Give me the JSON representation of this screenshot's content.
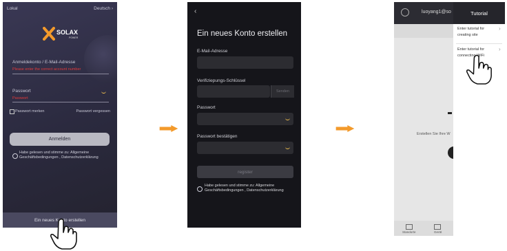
{
  "login": {
    "mode_label": "Lokal",
    "language_label": "Deutsch",
    "brand_text": "SOLAX",
    "brand_sub": "POWER",
    "account_placeholder": "Anmeldekonto / E-Mail-Adresse",
    "account_error": "Please enter the correct account number",
    "password_placeholder": "Passwort",
    "password_error": "Passwort",
    "remember_label": "Passwort merken",
    "forgot_label": "Passwort vergessen",
    "login_button": "Anmelden",
    "terms_text": "Habe gelesen und stimme zu: Allgemeine Geschäftsbedingungen , Datenschutzerklärung",
    "create_account": "Ein neues Konto erstellen"
  },
  "register": {
    "back_glyph": "‹",
    "title": "Ein neues Konto erstellen",
    "email_label": "E-Mail-Adresse",
    "key_label": "Verifiziерungs-Schlüssel",
    "send_label": "Senden",
    "password_label": "Passwort",
    "confirm_label": "Passwort bestätigen",
    "register_button": "register",
    "terms_text": "Habe gelesen und stimme zu: Allgemeine Geschäftsbedingungen , Datenschutzerklärung"
  },
  "tutorial": {
    "account": "luoyang1@so",
    "panel_title": "Tutorial",
    "item1": "Enter tutorial for creating site",
    "item2": "Enter tutorial for connecting WiFi",
    "center_text": "Erstellen Sie Ihre W",
    "nav1": "Standorte",
    "nav2": "Gerät",
    "chevron": "›"
  },
  "colors": {
    "accent_orange": "#f39a2b",
    "error_red": "#e23a3a",
    "eye_yellow": "#f2c14e"
  }
}
